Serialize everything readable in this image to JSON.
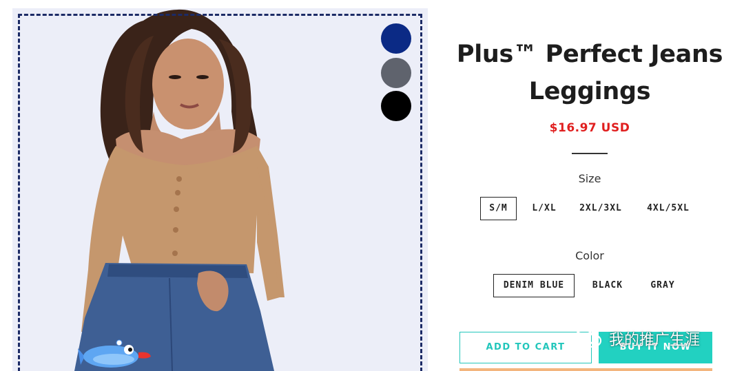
{
  "product": {
    "title": "Plus™ Perfect Jeans Leggings",
    "price": "$16.97 USD"
  },
  "swatches": [
    {
      "color": "#0b2a85"
    },
    {
      "color": "#5f636d"
    },
    {
      "color": "#000000"
    }
  ],
  "size": {
    "label": "Size",
    "options": [
      "S/M",
      "L/XL",
      "2XL/3XL",
      "4XL/5XL"
    ],
    "selected": "S/M"
  },
  "color": {
    "label": "Color",
    "options": [
      "DENIM BLUE",
      "BLACK",
      "GRAY"
    ],
    "selected": "DENIM BLUE"
  },
  "actions": {
    "add_to_cart": "ADD TO CART",
    "buy_it_now": "BUY IT NOW"
  },
  "watermark": {
    "text": "我的推广生涯",
    "icon": "wechat-icon"
  },
  "theme": {
    "price_color": "#e01f1f",
    "accent": "#22c6bb",
    "border_dash": "#1c2b66"
  }
}
